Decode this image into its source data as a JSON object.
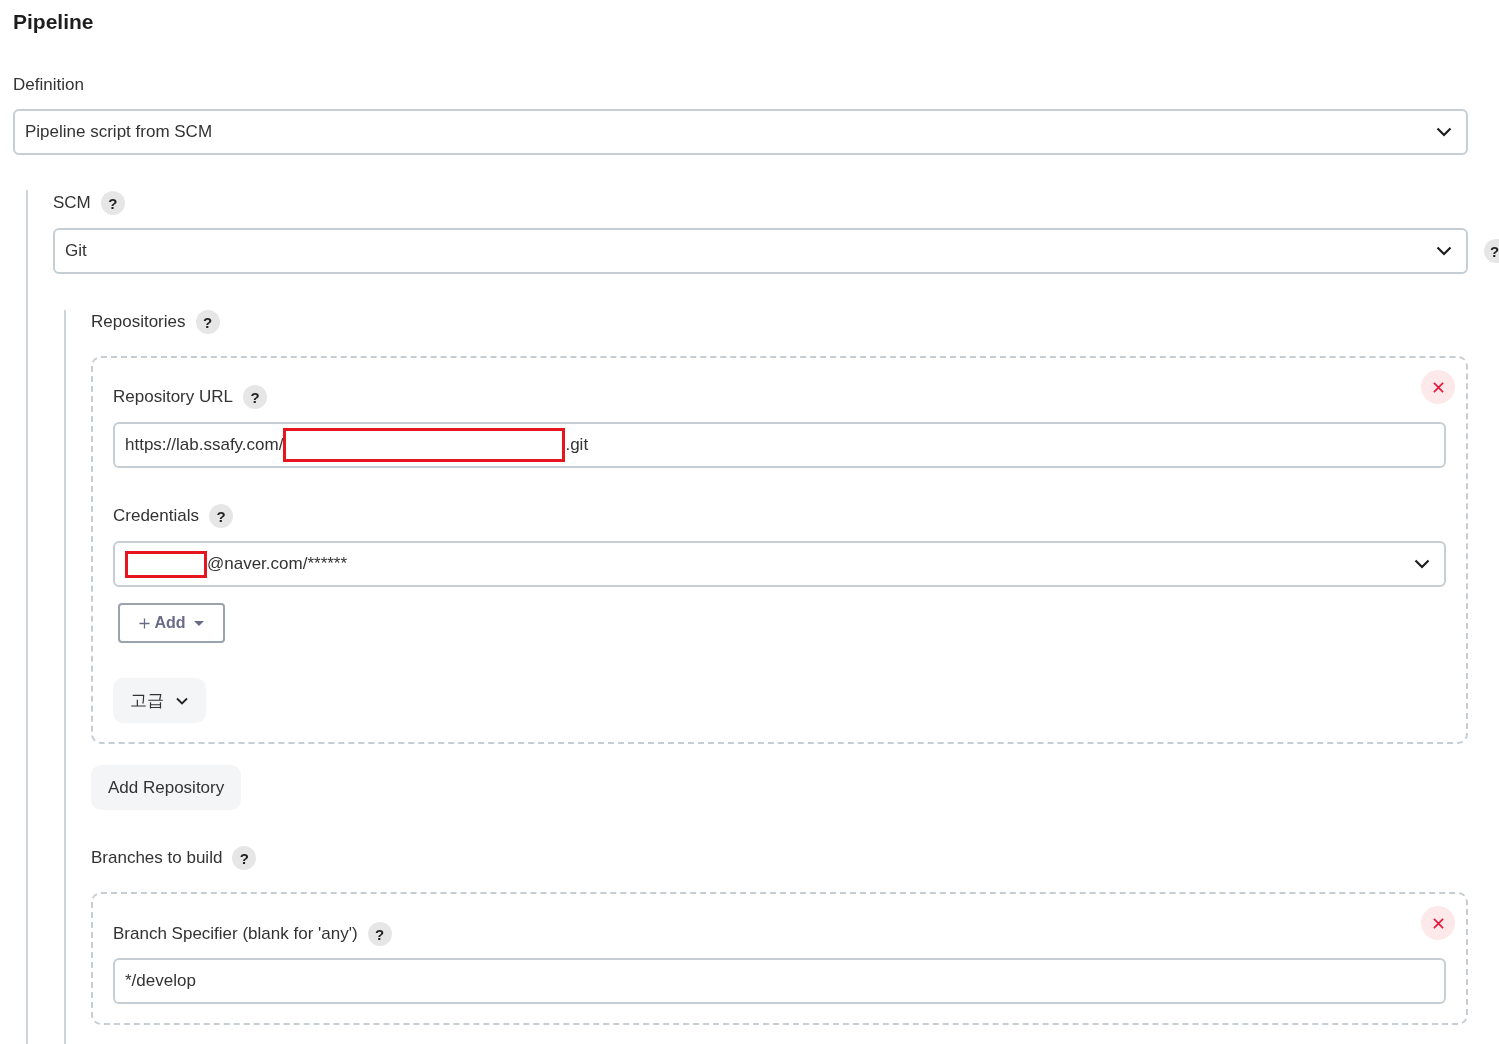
{
  "section_title": "Pipeline",
  "definition": {
    "label": "Definition",
    "select_value": "Pipeline script from SCM"
  },
  "scm": {
    "label": "SCM",
    "help": "?",
    "select_value": "Git",
    "side_help": "?",
    "repositories": {
      "label": "Repositories",
      "help": "?",
      "items": [
        {
          "url": {
            "label": "Repository URL",
            "help": "?",
            "value_parts": [
              {
                "kind": "text",
                "text": "https://lab.ssafy.com/"
              },
              {
                "kind": "redaction"
              },
              {
                "kind": "text",
                "text": ".git"
              }
            ]
          },
          "credentials": {
            "label": "Credentials",
            "help": "?",
            "value_parts": [
              {
                "kind": "redaction"
              },
              {
                "kind": "text",
                "text": "@naver.com/******"
              }
            ]
          },
          "add_button": "Add",
          "advanced_button": "고급"
        }
      ],
      "add_repository_button": "Add Repository"
    },
    "branches": {
      "label": "Branches to build",
      "help": "?",
      "items": [
        {
          "label": "Branch Specifier (blank for 'any')",
          "help": "?",
          "value": "*/develop"
        }
      ]
    }
  }
}
